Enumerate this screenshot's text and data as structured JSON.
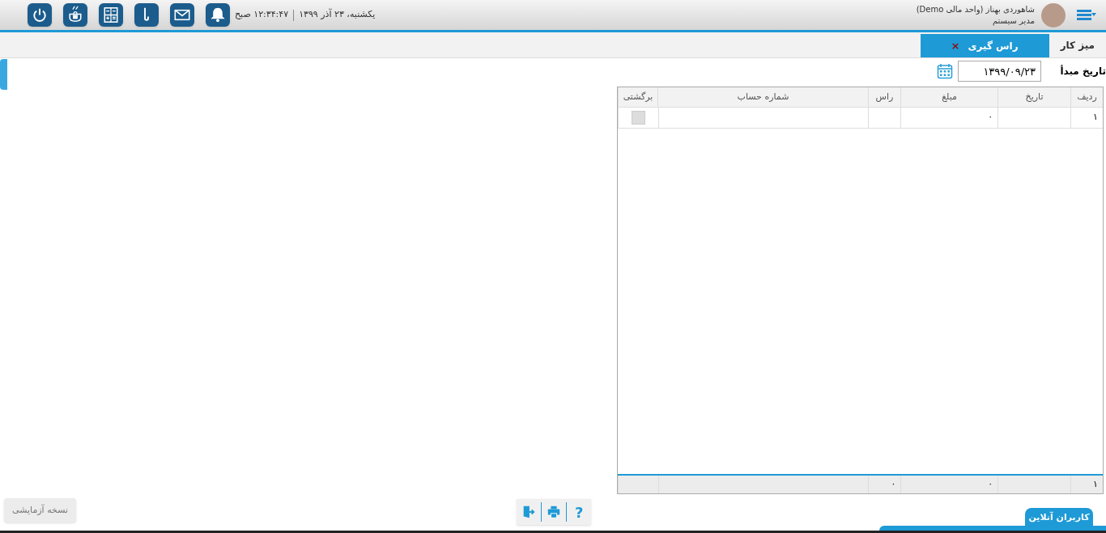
{
  "header": {
    "user_name": "شاهوردی بهناز (واحد مالی Demo)",
    "user_role": "مدیر سیستم",
    "date": "یکشنبه، ۲۳ آذر ۱۳۹۹",
    "time": "۱۲:۳۴:۴۷ صبح",
    "toolbar": [
      {
        "kind": "bell"
      },
      {
        "kind": "mail"
      },
      {
        "kind": "hook"
      },
      {
        "kind": "calculator"
      },
      {
        "kind": "coffee"
      },
      {
        "kind": "power"
      }
    ]
  },
  "tabs": [
    {
      "label": "میز کار",
      "selected": false
    },
    {
      "label": "راس گیری",
      "selected": true,
      "close": "×"
    }
  ],
  "filter": {
    "label": "تاریخ مبدأ",
    "value": "۱۳۹۹/۰۹/۲۳"
  },
  "table": {
    "columns": [
      "ردیف",
      "تاریخ",
      "مبلغ",
      "راس",
      "شماره حساب",
      "برگشتی"
    ],
    "rows": [
      {
        "row_no": "۱",
        "amount": "۰",
        "returned": false
      }
    ],
    "footer": {
      "row_no": "۱",
      "amount": "۰",
      "head": "۰"
    }
  },
  "bottom_toolbar": {
    "help": "?",
    "buttons": [
      {
        "kind": "print"
      },
      {
        "kind": "exit"
      }
    ]
  },
  "trial_badge": "نسخه آزمایشی",
  "online_users_tab": "کاربران آنلاین"
}
